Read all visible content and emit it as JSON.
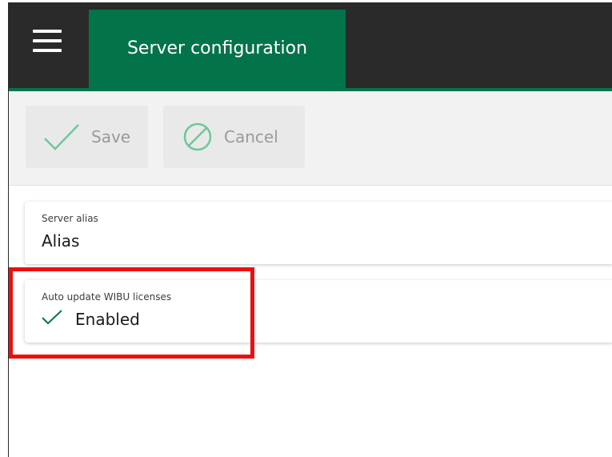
{
  "header": {
    "menu_icon": "hamburger-menu-icon",
    "tab_title": "Server configuration"
  },
  "toolbar": {
    "save_label": "Save",
    "save_icon": "checkmark-icon",
    "cancel_label": "Cancel",
    "cancel_icon": "cancel-circle-icon"
  },
  "fields": {
    "server_alias": {
      "label": "Server alias",
      "value": "Alias"
    },
    "auto_update": {
      "label": "Auto update WIBU licenses",
      "value": "Enabled",
      "icon": "checkmark-icon"
    }
  },
  "colors": {
    "header_bg": "#2a2a2a",
    "accent_green": "#03744a",
    "toolbar_bg": "#f2f2f2",
    "disabled_icon": "#6fc79a",
    "highlight": "#ee0e0e"
  }
}
